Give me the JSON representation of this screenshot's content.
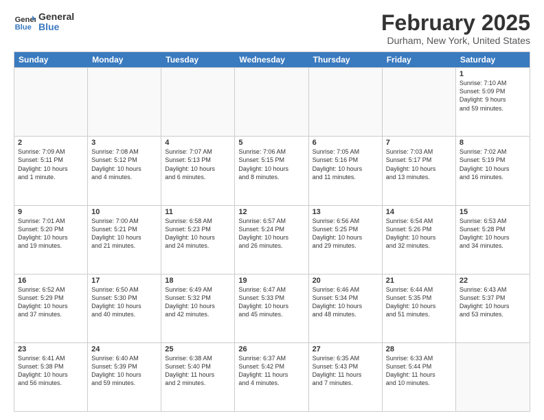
{
  "header": {
    "logo_line1": "General",
    "logo_line2": "Blue",
    "month_title": "February 2025",
    "location": "Durham, New York, United States"
  },
  "days_of_week": [
    "Sunday",
    "Monday",
    "Tuesday",
    "Wednesday",
    "Thursday",
    "Friday",
    "Saturday"
  ],
  "rows": [
    [
      {
        "day": "",
        "text": ""
      },
      {
        "day": "",
        "text": ""
      },
      {
        "day": "",
        "text": ""
      },
      {
        "day": "",
        "text": ""
      },
      {
        "day": "",
        "text": ""
      },
      {
        "day": "",
        "text": ""
      },
      {
        "day": "1",
        "text": "Sunrise: 7:10 AM\nSunset: 5:09 PM\nDaylight: 9 hours\nand 59 minutes."
      }
    ],
    [
      {
        "day": "2",
        "text": "Sunrise: 7:09 AM\nSunset: 5:11 PM\nDaylight: 10 hours\nand 1 minute."
      },
      {
        "day": "3",
        "text": "Sunrise: 7:08 AM\nSunset: 5:12 PM\nDaylight: 10 hours\nand 4 minutes."
      },
      {
        "day": "4",
        "text": "Sunrise: 7:07 AM\nSunset: 5:13 PM\nDaylight: 10 hours\nand 6 minutes."
      },
      {
        "day": "5",
        "text": "Sunrise: 7:06 AM\nSunset: 5:15 PM\nDaylight: 10 hours\nand 8 minutes."
      },
      {
        "day": "6",
        "text": "Sunrise: 7:05 AM\nSunset: 5:16 PM\nDaylight: 10 hours\nand 11 minutes."
      },
      {
        "day": "7",
        "text": "Sunrise: 7:03 AM\nSunset: 5:17 PM\nDaylight: 10 hours\nand 13 minutes."
      },
      {
        "day": "8",
        "text": "Sunrise: 7:02 AM\nSunset: 5:19 PM\nDaylight: 10 hours\nand 16 minutes."
      }
    ],
    [
      {
        "day": "9",
        "text": "Sunrise: 7:01 AM\nSunset: 5:20 PM\nDaylight: 10 hours\nand 19 minutes."
      },
      {
        "day": "10",
        "text": "Sunrise: 7:00 AM\nSunset: 5:21 PM\nDaylight: 10 hours\nand 21 minutes."
      },
      {
        "day": "11",
        "text": "Sunrise: 6:58 AM\nSunset: 5:23 PM\nDaylight: 10 hours\nand 24 minutes."
      },
      {
        "day": "12",
        "text": "Sunrise: 6:57 AM\nSunset: 5:24 PM\nDaylight: 10 hours\nand 26 minutes."
      },
      {
        "day": "13",
        "text": "Sunrise: 6:56 AM\nSunset: 5:25 PM\nDaylight: 10 hours\nand 29 minutes."
      },
      {
        "day": "14",
        "text": "Sunrise: 6:54 AM\nSunset: 5:26 PM\nDaylight: 10 hours\nand 32 minutes."
      },
      {
        "day": "15",
        "text": "Sunrise: 6:53 AM\nSunset: 5:28 PM\nDaylight: 10 hours\nand 34 minutes."
      }
    ],
    [
      {
        "day": "16",
        "text": "Sunrise: 6:52 AM\nSunset: 5:29 PM\nDaylight: 10 hours\nand 37 minutes."
      },
      {
        "day": "17",
        "text": "Sunrise: 6:50 AM\nSunset: 5:30 PM\nDaylight: 10 hours\nand 40 minutes."
      },
      {
        "day": "18",
        "text": "Sunrise: 6:49 AM\nSunset: 5:32 PM\nDaylight: 10 hours\nand 42 minutes."
      },
      {
        "day": "19",
        "text": "Sunrise: 6:47 AM\nSunset: 5:33 PM\nDaylight: 10 hours\nand 45 minutes."
      },
      {
        "day": "20",
        "text": "Sunrise: 6:46 AM\nSunset: 5:34 PM\nDaylight: 10 hours\nand 48 minutes."
      },
      {
        "day": "21",
        "text": "Sunrise: 6:44 AM\nSunset: 5:35 PM\nDaylight: 10 hours\nand 51 minutes."
      },
      {
        "day": "22",
        "text": "Sunrise: 6:43 AM\nSunset: 5:37 PM\nDaylight: 10 hours\nand 53 minutes."
      }
    ],
    [
      {
        "day": "23",
        "text": "Sunrise: 6:41 AM\nSunset: 5:38 PM\nDaylight: 10 hours\nand 56 minutes."
      },
      {
        "day": "24",
        "text": "Sunrise: 6:40 AM\nSunset: 5:39 PM\nDaylight: 10 hours\nand 59 minutes."
      },
      {
        "day": "25",
        "text": "Sunrise: 6:38 AM\nSunset: 5:40 PM\nDaylight: 11 hours\nand 2 minutes."
      },
      {
        "day": "26",
        "text": "Sunrise: 6:37 AM\nSunset: 5:42 PM\nDaylight: 11 hours\nand 4 minutes."
      },
      {
        "day": "27",
        "text": "Sunrise: 6:35 AM\nSunset: 5:43 PM\nDaylight: 11 hours\nand 7 minutes."
      },
      {
        "day": "28",
        "text": "Sunrise: 6:33 AM\nSunset: 5:44 PM\nDaylight: 11 hours\nand 10 minutes."
      },
      {
        "day": "",
        "text": ""
      }
    ]
  ]
}
